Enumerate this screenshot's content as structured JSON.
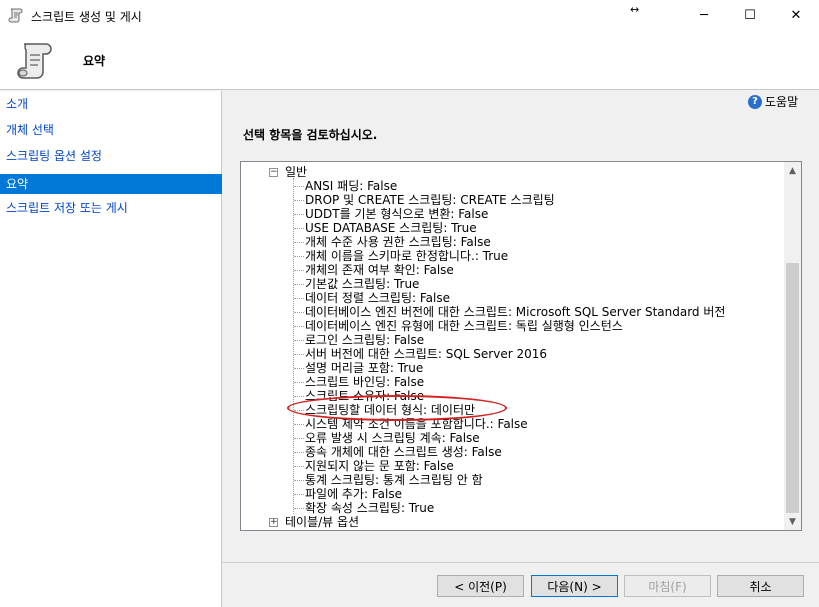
{
  "window": {
    "title": "스크립트 생성 및 게시",
    "resize_glyph": "↔",
    "controls": {
      "minimize": "─",
      "maximize": "☐",
      "close": "✕"
    }
  },
  "header": {
    "title": "요약",
    "icon": "scroll-icon"
  },
  "sidebar": {
    "items": [
      {
        "label": "소개",
        "active": false
      },
      {
        "label": "개체 선택",
        "active": false
      },
      {
        "label": "스크립팅 옵션 설정",
        "active": false
      },
      {
        "label": "요약",
        "active": true
      },
      {
        "label": "스크립트 저장 또는 게시",
        "active": false
      }
    ]
  },
  "help": {
    "label": "도움말",
    "icon": "help-icon",
    "glyph": "?"
  },
  "main": {
    "heading": "선택 항목을 검토하십시오."
  },
  "tree": {
    "general": {
      "label": "일반",
      "expander": "−"
    },
    "items": [
      "ANSI 패딩: False",
      "DROP 및 CREATE 스크립팅: CREATE 스크립팅",
      "UDDT를 기본 형식으로 변환: False",
      "USE DATABASE 스크립팅: True",
      "개체 수준 사용 권한 스크립팅: False",
      "개체 이름을 스키마로 한정합니다.: True",
      "개체의 존재 여부 확인: False",
      "기본값 스크립팅: True",
      "데이터 정렬 스크립팅: False",
      "데이터베이스 엔진 버전에 대한 스크립트: Microsoft SQL Server Standard 버전",
      "데이터베이스 엔진 유형에 대한 스크립트: 독립 실행형 인스턴스",
      "로그인 스크립팅: False",
      "서버 버전에 대한 스크립트: SQL Server 2016",
      "설명 머리글 포함: True",
      "스크립트 바인딩: False",
      "스크립트 소유자: False",
      "스크립팅할 데이터 형식: 데이터만",
      "시스템 제약 조건 이름을 포함합니다.: False",
      "오류 발생 시 스크립팅 계속: False",
      "종속 개체에 대한 스크립트 생성: False",
      "지원되지 않는 문 포함: False",
      "통계 스크립팅: 통계 스크립팅 안 함",
      "파일에 추가: False",
      "확장 속성 스크립팅: True"
    ],
    "table_view": {
      "label": "테이블/뷰 옵션",
      "expander": "+"
    },
    "highlight_color": "#d32020"
  },
  "scrollbar": {
    "up": "▲",
    "down": "▼",
    "thumb_fraction": 0.75,
    "thumb_offset_fraction": 0.25
  },
  "buttons": {
    "prev": "< 이전(P)",
    "next": "다음(N) >",
    "finish": "마침(F)",
    "cancel": "취소"
  },
  "colors": {
    "accent": "#0078d7",
    "link": "#0046c8"
  }
}
